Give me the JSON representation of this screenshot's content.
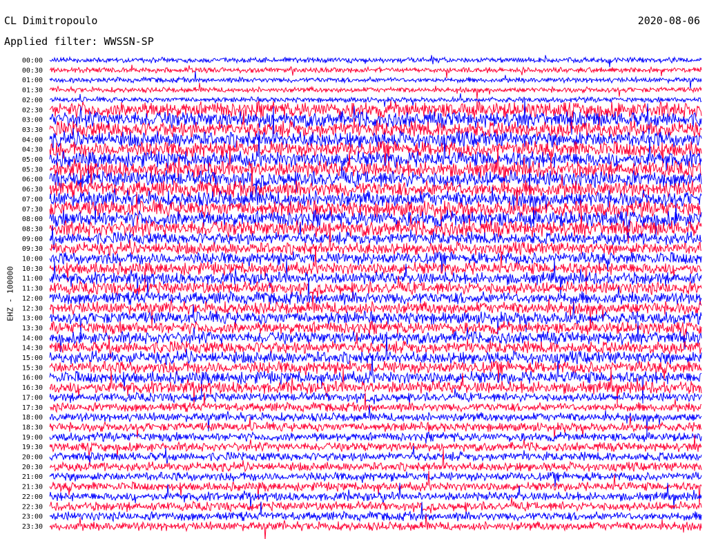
{
  "header": {
    "station": "CL Dimitropoulo",
    "date": "2020-08-06",
    "filter": "Applied filter: WWSSN-SP"
  },
  "chart_data": {
    "type": "line",
    "title": "CL Dimitropoulo",
    "ylabel": "EHZ - 100000",
    "row_labels": [
      "00:00",
      "00:30",
      "01:00",
      "01:30",
      "02:00",
      "02:30",
      "03:00",
      "03:30",
      "04:00",
      "04:30",
      "05:00",
      "05:30",
      "06:00",
      "06:30",
      "07:00",
      "07:30",
      "08:00",
      "08:30",
      "09:00",
      "09:30",
      "10:00",
      "10:30",
      "11:00",
      "11:30",
      "12:00",
      "12:30",
      "13:00",
      "13:30",
      "14:00",
      "14:30",
      "15:00",
      "15:30",
      "16:00",
      "16:30",
      "17:00",
      "17:30",
      "18:00",
      "18:30",
      "19:00",
      "19:30",
      "20:00",
      "20:30",
      "21:00",
      "21:30",
      "22:00",
      "22:30",
      "23:00",
      "23:30"
    ],
    "series_colors": [
      "#0000ff",
      "#ff0033"
    ],
    "grid": false
  }
}
